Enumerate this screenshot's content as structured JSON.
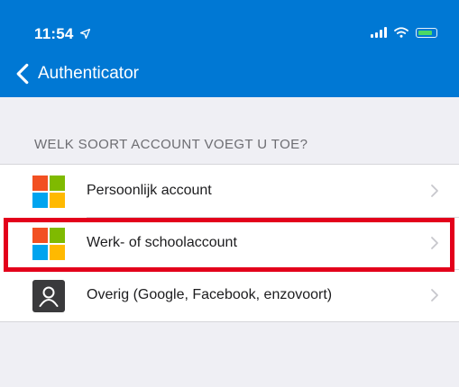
{
  "status_bar": {
    "time": "11:54",
    "icons": [
      "location-arrow-icon",
      "signal-icon",
      "wifi-icon",
      "battery-charging-icon"
    ]
  },
  "nav": {
    "back_label": "Authenticator"
  },
  "section": {
    "header": "WELK SOORT ACCOUNT VOEGT U TOE?"
  },
  "accounts": [
    {
      "label": "Persoonlijk account",
      "icon": "microsoft-logo-icon"
    },
    {
      "label": "Werk- of schoolaccount",
      "icon": "microsoft-logo-icon",
      "highlighted": true
    },
    {
      "label": "Overig (Google, Facebook, enzovoort)",
      "icon": "person-icon"
    }
  ],
  "colors": {
    "header": "#0078d4",
    "highlight": "#e3001b",
    "ms_red": "#f25022",
    "ms_green": "#7fba00",
    "ms_blue": "#00a4ef",
    "ms_yellow": "#ffb900"
  }
}
